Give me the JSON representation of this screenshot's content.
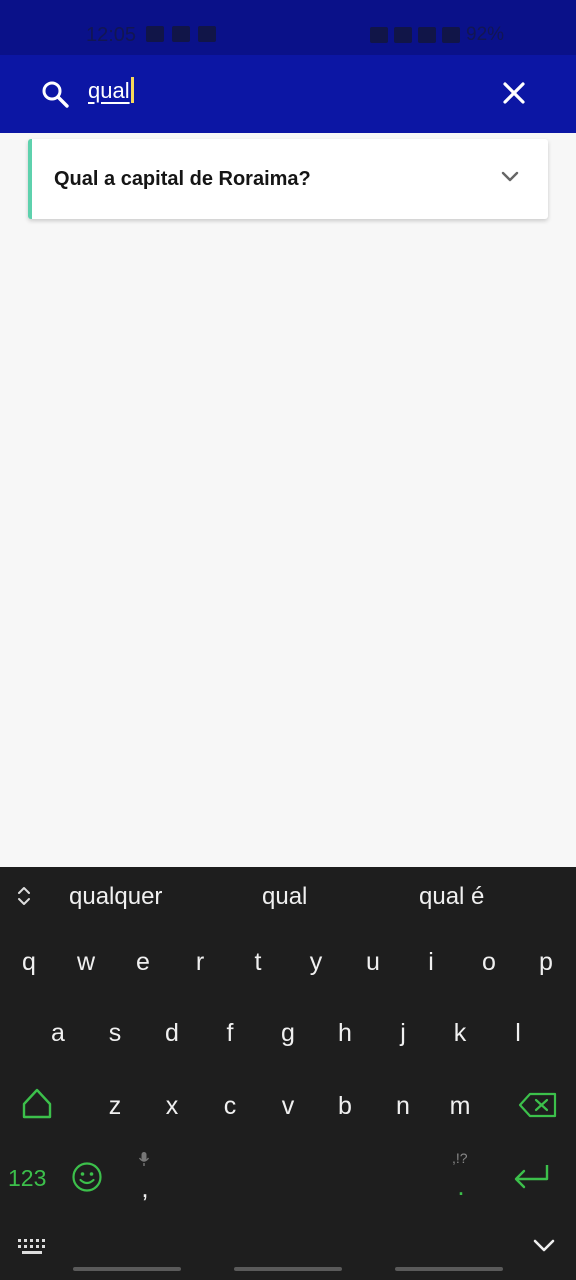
{
  "status_bar": {
    "time": "12:05",
    "battery": "92%"
  },
  "search": {
    "value": "qual"
  },
  "results": [
    {
      "title": "Qual a capital de Roraima?"
    }
  ],
  "keyboard": {
    "suggestions": [
      "qualquer",
      "qual",
      "qual é"
    ],
    "row1": [
      "q",
      "w",
      "e",
      "r",
      "t",
      "y",
      "u",
      "i",
      "o",
      "p"
    ],
    "row2": [
      "a",
      "s",
      "d",
      "f",
      "g",
      "h",
      "j",
      "k",
      "l"
    ],
    "row3": [
      "z",
      "x",
      "c",
      "v",
      "b",
      "n",
      "m"
    ],
    "numbers_key": "123",
    "comma_key": ",",
    "period_key": ".",
    "punct_hint": ",!?"
  },
  "colors": {
    "status_bar": "#0a1189",
    "app_bar": "#0c16a4",
    "card_accent": "#5ed1ad",
    "keyboard_bg": "#1e1e1e",
    "keyboard_accent": "#3cc04b"
  },
  "icons": [
    "search-icon",
    "close-icon",
    "chevron-down-icon",
    "suggestion-toggle-icon",
    "shift-icon",
    "backspace-icon",
    "emoji-icon",
    "microphone-icon",
    "enter-icon",
    "keyboard-icon",
    "hide-keyboard-icon"
  ]
}
